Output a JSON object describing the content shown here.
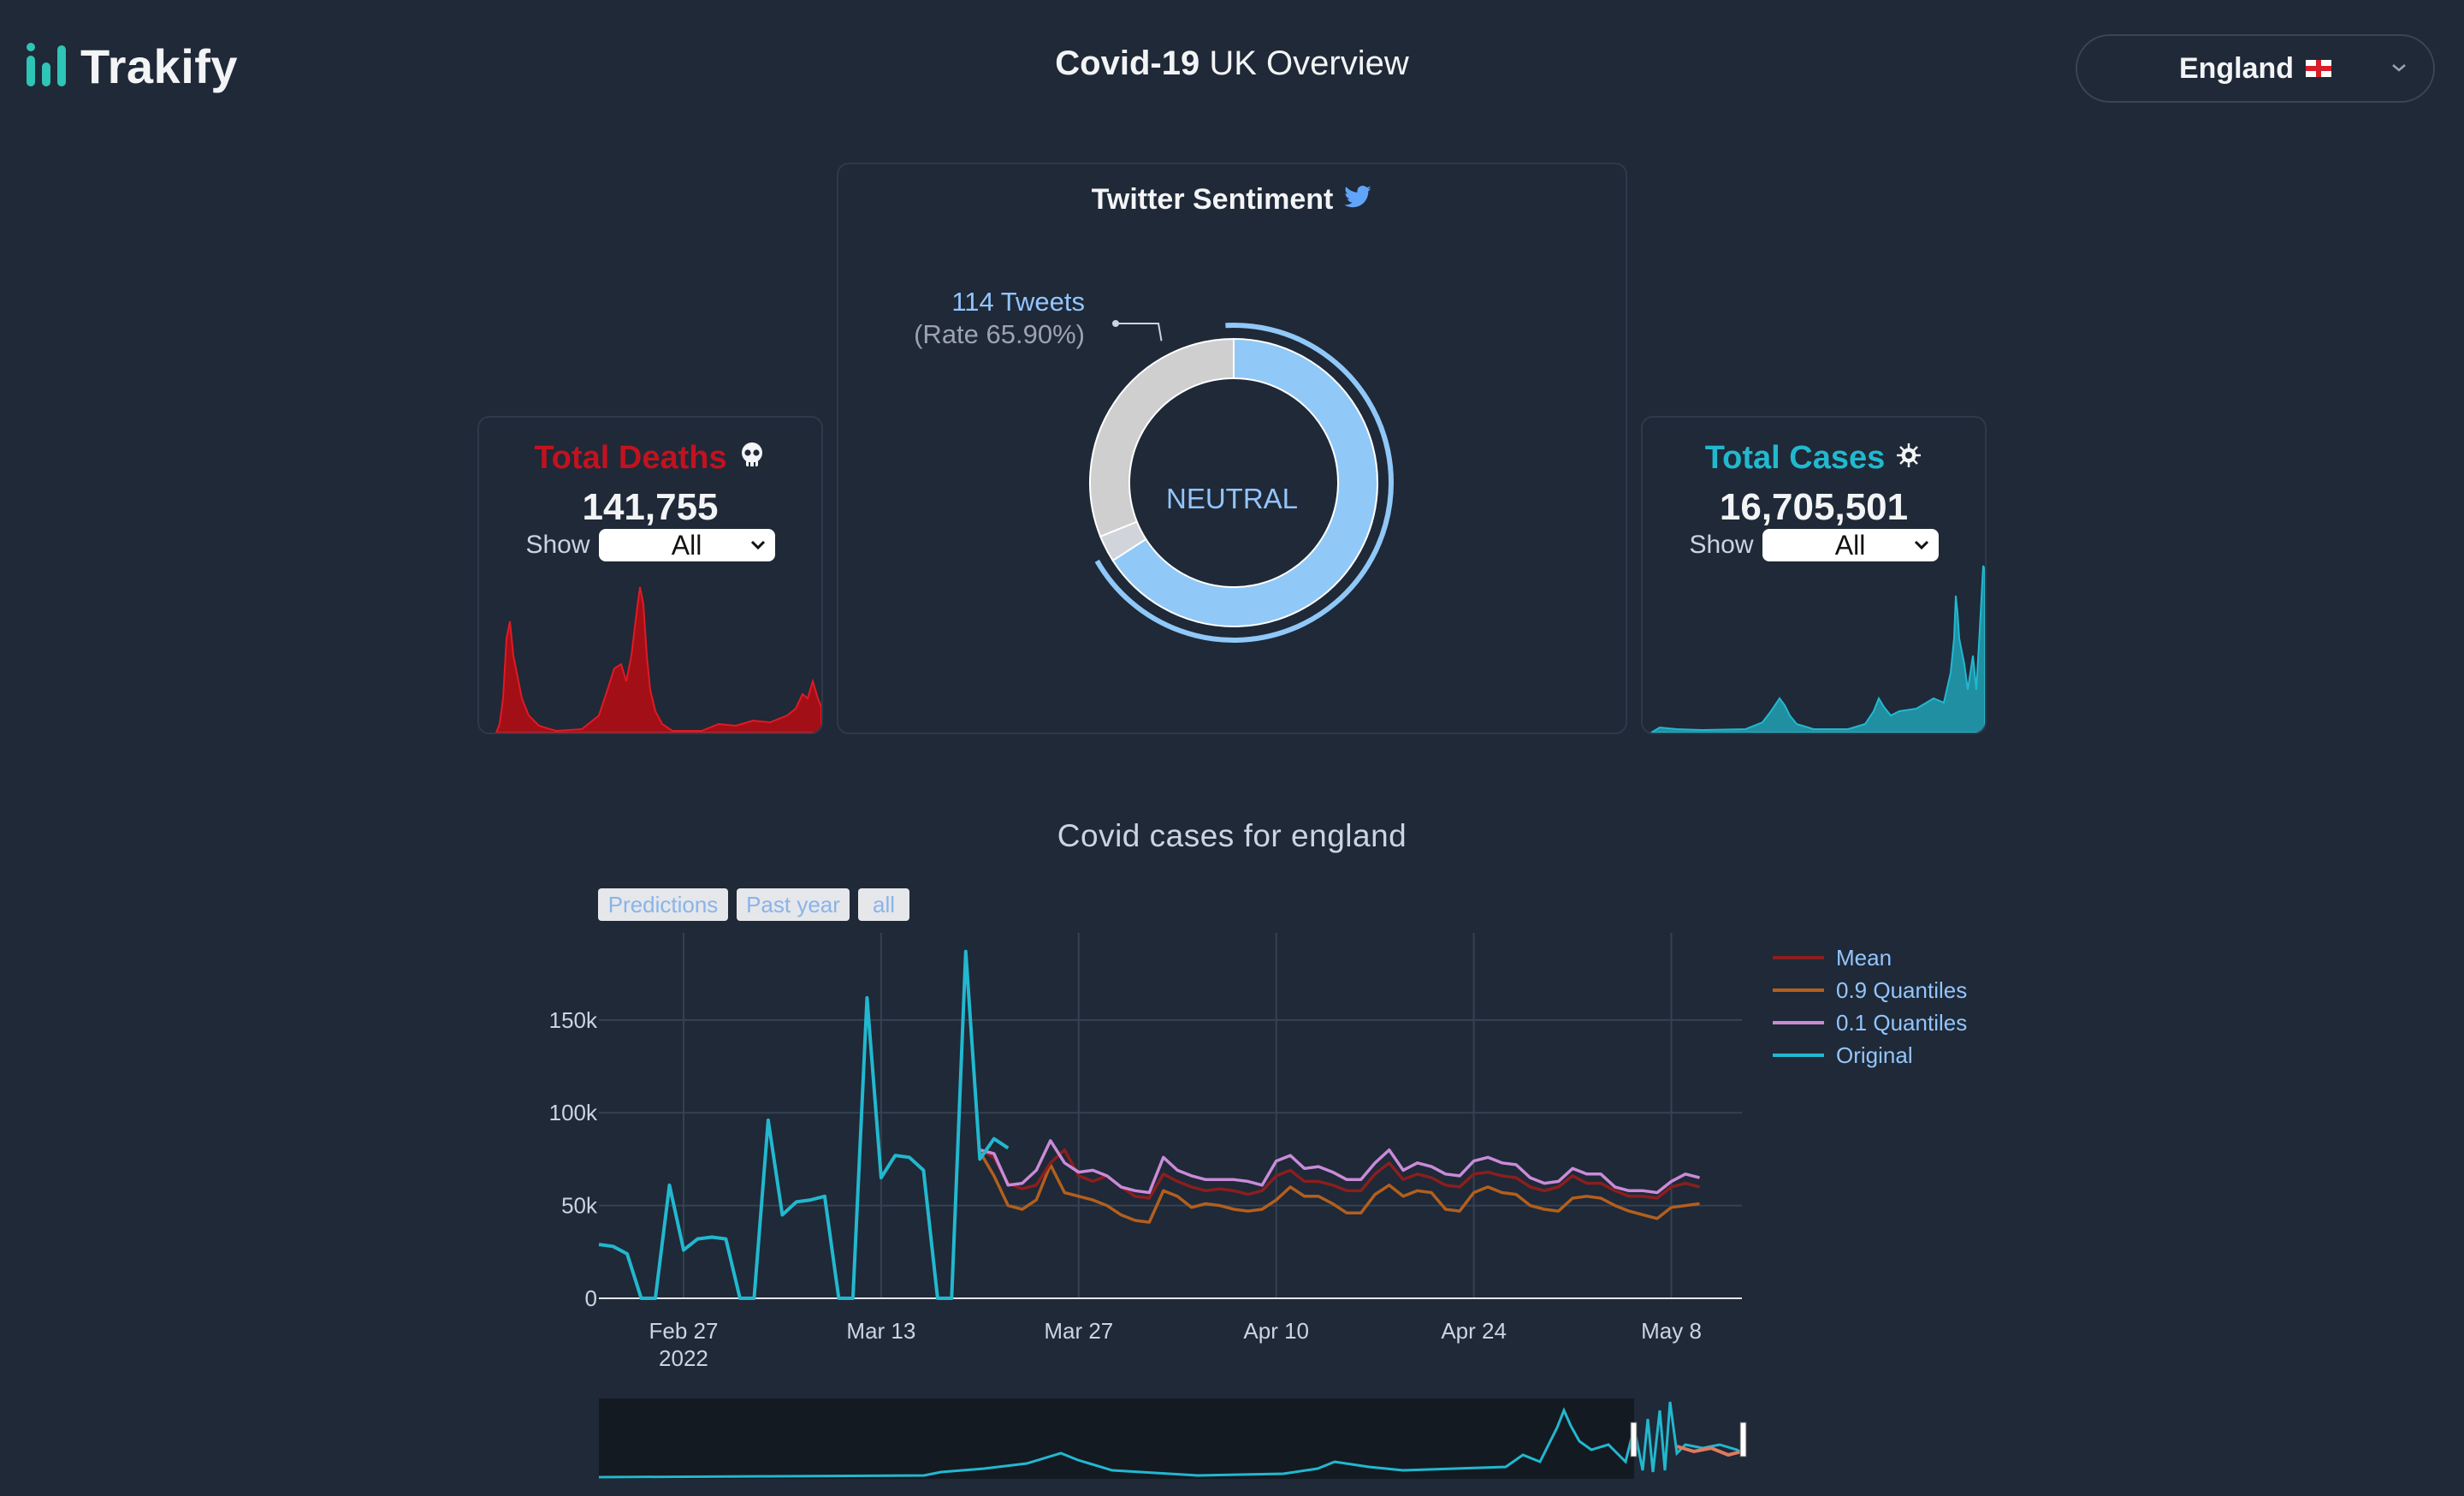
{
  "app": {
    "name": "Trakify"
  },
  "header": {
    "title_bold": "Covid-19",
    "title_rest": " UK Overview"
  },
  "region": {
    "selected": "England"
  },
  "deaths": {
    "title": "Total Deaths",
    "value": "141,755",
    "show_label": "Show",
    "show_value": "All",
    "color": "#c1121f"
  },
  "cases": {
    "title": "Total Cases",
    "value": "16,705,501",
    "show_label": "Show",
    "show_value": "All",
    "color": "#22b8cf"
  },
  "sentiment": {
    "title": "Twitter Sentiment",
    "tweets_label": "114 Tweets",
    "rate_label": "(Rate 65.90%)",
    "center_label": "NEUTRAL",
    "segments": [
      {
        "name": "neutral",
        "fraction": 0.659,
        "color": "#90c8f8"
      },
      {
        "name": "other-a",
        "fraction": 0.03,
        "color": "#d1d5db"
      },
      {
        "name": "other-b",
        "fraction": 0.311,
        "color": "#cfcfcf"
      }
    ]
  },
  "chart": {
    "title": "Covid cases for england",
    "range_buttons": [
      "Predictions",
      "Past year",
      "all"
    ]
  },
  "chart_data": {
    "type": "line",
    "title": "Covid cases for england",
    "x_tick_labels": [
      "Feb 27\n2022",
      "Mar 13",
      "Mar 27",
      "Apr 10",
      "Apr 24",
      "May 8"
    ],
    "x_range": [
      "2022-02-21",
      "2022-05-13"
    ],
    "y_tick_labels": [
      "0",
      "50k",
      "100k",
      "150k"
    ],
    "ylim": [
      0,
      197000
    ],
    "grid": true,
    "legend_position": "right",
    "series": [
      {
        "name": "Mean",
        "color": "#8b1e1e",
        "start": "2022-03-20",
        "values": [
          80000,
          76000,
          62000,
          59000,
          61000,
          73000,
          80000,
          66000,
          63000,
          66000,
          60000,
          55000,
          54000,
          67000,
          63000,
          60000,
          58000,
          59000,
          58000,
          56000,
          58000,
          66000,
          69000,
          63000,
          63000,
          61000,
          58000,
          58000,
          67000,
          73000,
          64000,
          67000,
          65000,
          61000,
          60000,
          67000,
          68000,
          66000,
          65000,
          60000,
          58000,
          60000,
          66000,
          62000,
          62000,
          58000,
          55000,
          55000,
          54000,
          60000,
          62000,
          60000
        ]
      },
      {
        "name": "0.9 Quantiles",
        "color": "#b35f1e",
        "start": "2022-03-20",
        "values": [
          79000,
          66000,
          50000,
          48000,
          53000,
          72000,
          57000,
          55000,
          53000,
          50000,
          45000,
          42000,
          41000,
          58000,
          55000,
          49000,
          51000,
          50000,
          48000,
          47000,
          48000,
          53000,
          60000,
          55000,
          55000,
          51000,
          46000,
          46000,
          56000,
          61000,
          55000,
          58000,
          57000,
          48000,
          47000,
          57000,
          60000,
          57000,
          56000,
          50000,
          48000,
          47000,
          54000,
          55000,
          54000,
          50000,
          47000,
          45000,
          43000,
          49000,
          50000,
          51000
        ]
      },
      {
        "name": "0.1 Quantiles",
        "color": "#c98bd8",
        "start": "2022-03-20",
        "values": [
          80000,
          78000,
          61000,
          62000,
          69000,
          85000,
          73000,
          68000,
          69000,
          66000,
          60000,
          58000,
          57000,
          76000,
          69000,
          66000,
          64000,
          64000,
          64000,
          63000,
          61000,
          74000,
          77000,
          70000,
          71000,
          68000,
          64000,
          64000,
          73000,
          80000,
          69000,
          73000,
          71000,
          67000,
          66000,
          74000,
          76000,
          73000,
          72000,
          65000,
          62000,
          63000,
          70000,
          67000,
          67000,
          60000,
          58000,
          58000,
          57000,
          63000,
          67000,
          65000
        ]
      },
      {
        "name": "Original",
        "color": "#22b8cf",
        "start": "2022-02-21",
        "values": [
          29000,
          28000,
          24000,
          0,
          0,
          61000,
          26000,
          32000,
          33000,
          32000,
          0,
          0,
          96000,
          45000,
          52000,
          53000,
          55000,
          0,
          0,
          162000,
          65000,
          77000,
          76000,
          69000,
          0,
          0,
          187000,
          75000,
          86000,
          81000
        ]
      }
    ]
  }
}
